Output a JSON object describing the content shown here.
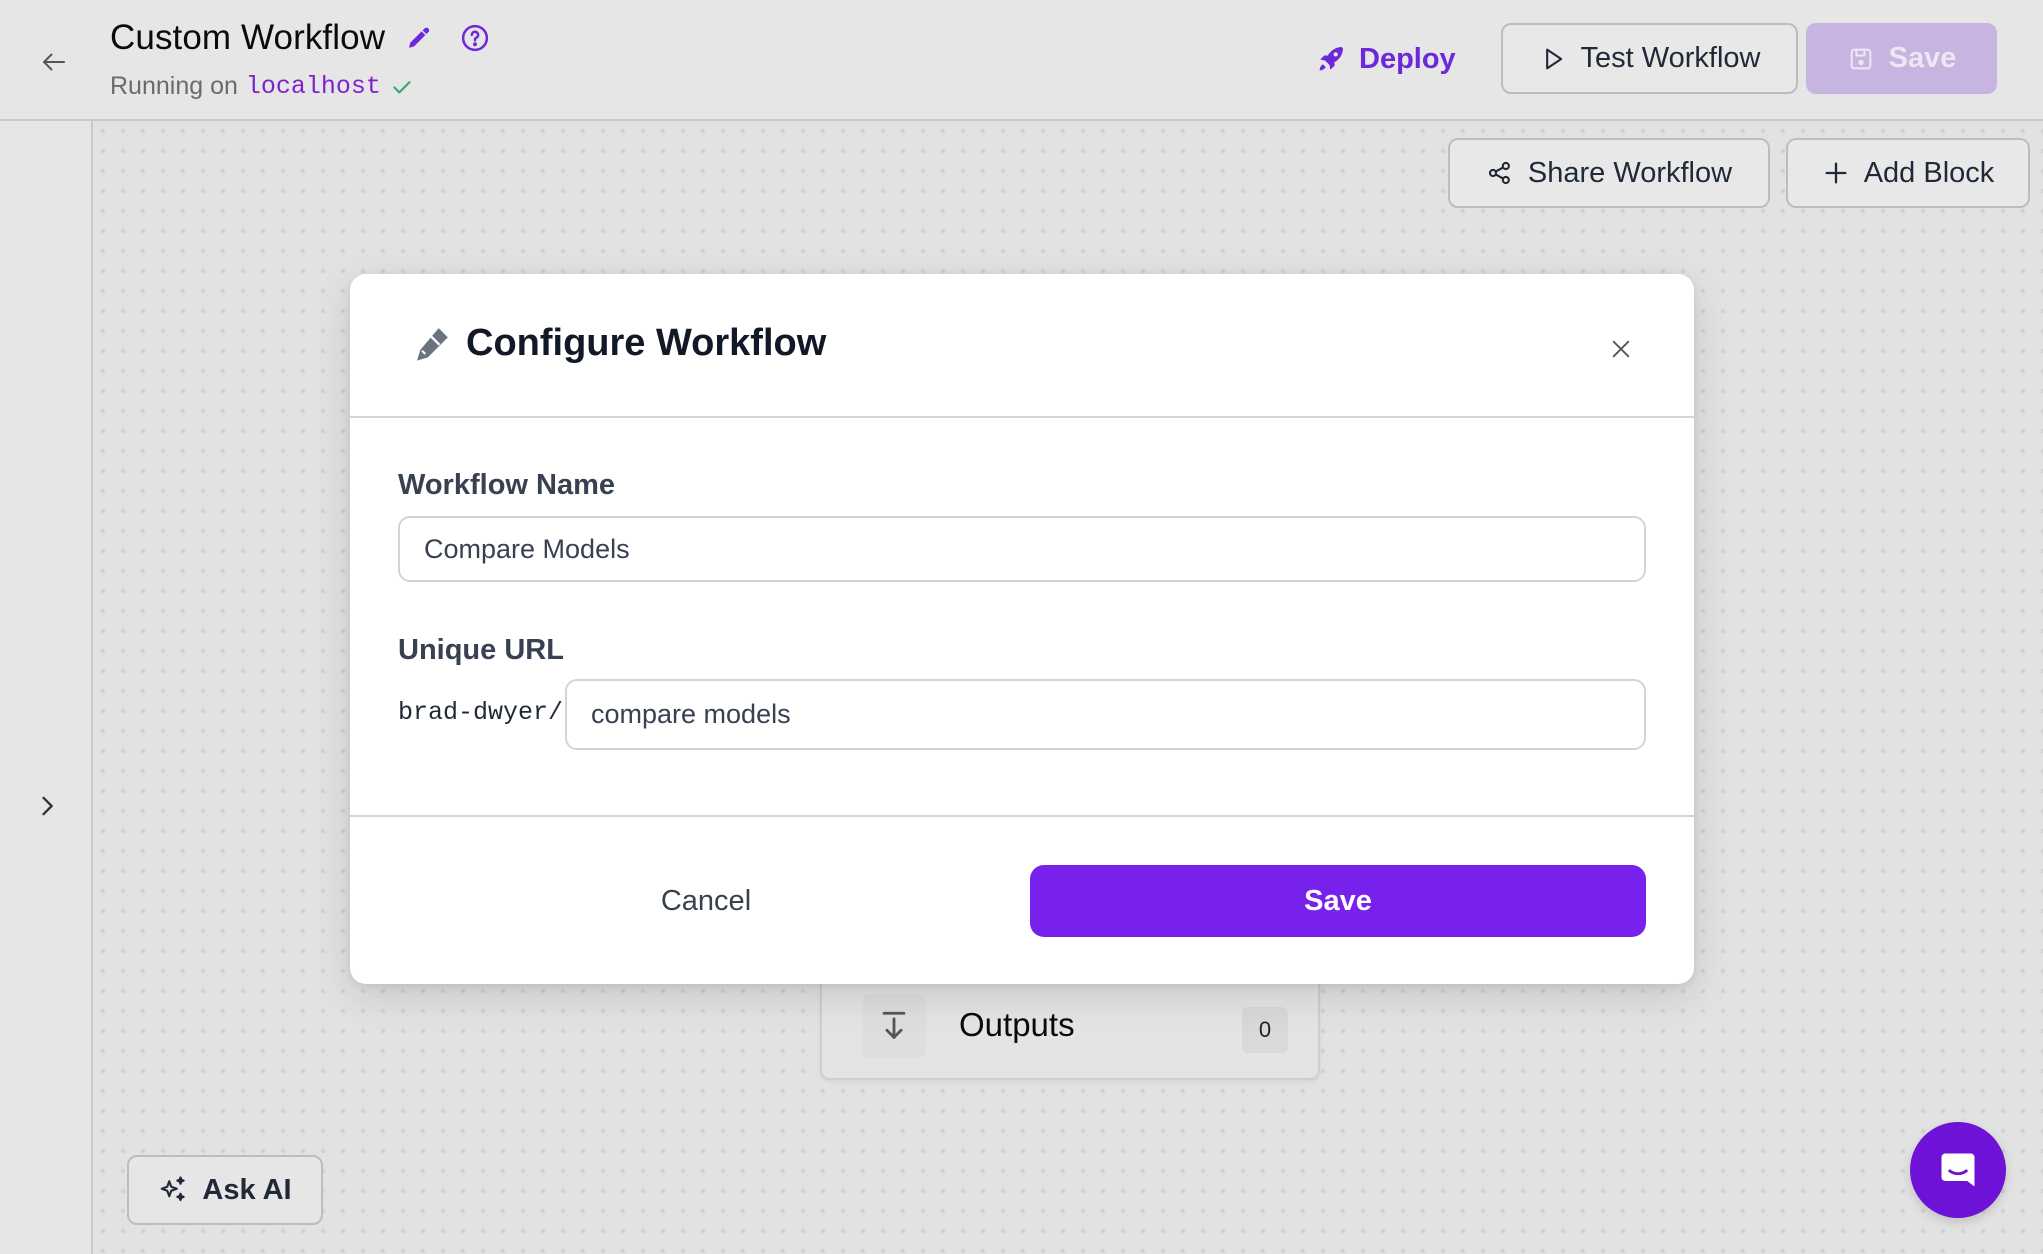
{
  "header": {
    "title": "Custom Workflow",
    "status_prefix": "Running on",
    "status_host": "localhost",
    "deploy_label": "Deploy",
    "test_label": "Test Workflow",
    "save_label": "Save"
  },
  "toolbar": {
    "share_label": "Share Workflow",
    "add_block_label": "Add Block"
  },
  "canvas": {
    "outputs_node": {
      "label": "Outputs",
      "count": "0"
    },
    "ask_ai_label": "Ask AI"
  },
  "modal": {
    "title": "Configure Workflow",
    "name_label": "Workflow Name",
    "name_value": "Compare Models",
    "url_label": "Unique URL",
    "url_prefix": "brad-dwyer/",
    "url_value": "compare models",
    "cancel_label": "Cancel",
    "save_label": "Save"
  },
  "colors": {
    "accent": "#7820ec",
    "deploy_text": "#6d28d9",
    "save_disabled": "#c8b4e0",
    "chat_bubble": "#6d12d6",
    "status_ok": "#3fa36b"
  },
  "icons": {
    "back": "arrow-left-icon",
    "edit": "pencil-icon",
    "help": "question-circle-icon",
    "status": "check-icon",
    "deploy": "rocket-icon",
    "test": "play-icon",
    "save": "floppy-disk-icon",
    "share": "share-nodes-icon",
    "add": "plus-icon",
    "sidebar": "chevron-right-icon",
    "outputs": "arrow-down-to-line-icon",
    "ask_ai": "sparkles-icon",
    "chat": "chat-bubble-icon",
    "close": "close-icon"
  }
}
